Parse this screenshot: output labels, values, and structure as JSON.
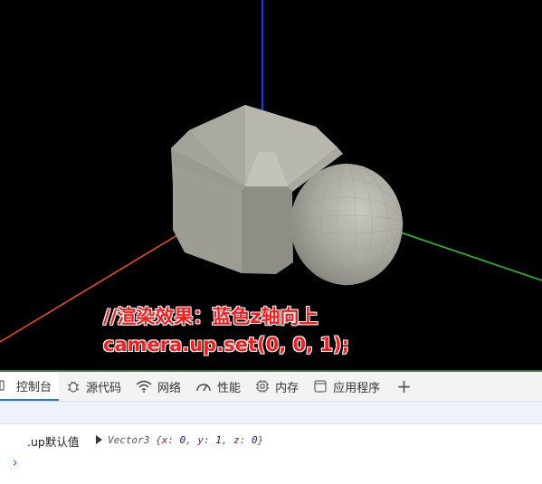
{
  "scene": {
    "axis_colors": {
      "x": "#ff4a1a",
      "y": "#22cc22",
      "z": "#2233ff"
    },
    "object_color": "#a6a69c"
  },
  "caption": {
    "line1": "//渲染效果：蓝色z轴向上",
    "line2": "camera.up.set(0, 0, 1);",
    "color": "#ff1a1a"
  },
  "devtools": {
    "tabs": [
      {
        "label": "控制台",
        "icon": "console-icon",
        "active": true
      },
      {
        "label": "源代码",
        "icon": "bug-icon"
      },
      {
        "label": "网络",
        "icon": "wifi-icon"
      },
      {
        "label": "性能",
        "icon": "gauge-icon"
      },
      {
        "label": "内存",
        "icon": "chip-icon"
      },
      {
        "label": "应用程序",
        "icon": "window-icon"
      }
    ],
    "add_tab_label": "+",
    "accent": "#1a73e8"
  },
  "console": {
    "label": ".up默认值",
    "object_type": "Vector3",
    "brace_open": "{",
    "brace_close": "}",
    "entries": [
      {
        "key": "x",
        "value": "0"
      },
      {
        "key": "y",
        "value": "1"
      },
      {
        "key": "z",
        "value": "0"
      }
    ],
    "prompt": "›"
  }
}
